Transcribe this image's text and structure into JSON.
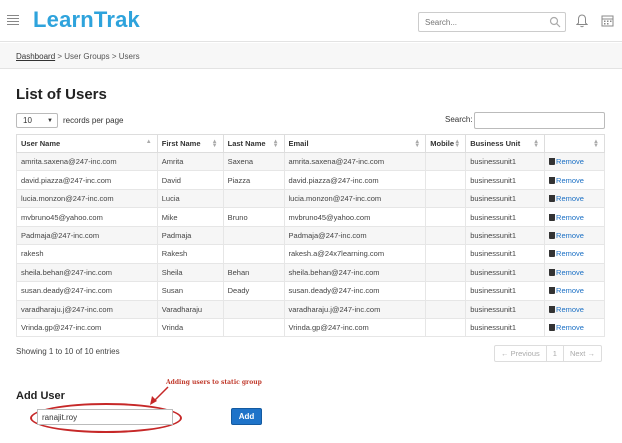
{
  "app": {
    "logo": "LearnTrak"
  },
  "header": {
    "search_placeholder": "Search..."
  },
  "breadcrumb": {
    "home": "Dashboard",
    "sep1": " > ",
    "groups": "User Groups",
    "sep2": " > ",
    "current": "Users"
  },
  "page": {
    "title": "List of Users"
  },
  "table_controls": {
    "page_length": "10",
    "records_label": "records per page",
    "search_label": "Search:"
  },
  "columns": [
    "User Name",
    "First Name",
    "Last Name",
    "Email",
    "Mobile",
    "Business Unit",
    ""
  ],
  "rows": [
    {
      "username": "amrita.saxena@247-inc.com",
      "first": "Amrita",
      "last": "Saxena",
      "email": "amrita.saxena@247-inc.com",
      "mobile": "",
      "unit": "businessunit1",
      "action": "Remove"
    },
    {
      "username": "david.piazza@247-inc.com",
      "first": "David",
      "last": "Piazza",
      "email": "david.piazza@247-inc.com",
      "mobile": "",
      "unit": "businessunit1",
      "action": "Remove"
    },
    {
      "username": "lucia.monzon@247-inc.com",
      "first": "Lucia",
      "last": "",
      "email": "lucia.monzon@247-inc.com",
      "mobile": "",
      "unit": "businessunit1",
      "action": "Remove"
    },
    {
      "username": "mvbruno45@yahoo.com",
      "first": "Mike",
      "last": "Bruno",
      "email": "mvbruno45@yahoo.com",
      "mobile": "",
      "unit": "businessunit1",
      "action": "Remove"
    },
    {
      "username": "Padmaja@247-inc.com",
      "first": "Padmaja",
      "last": "",
      "email": "Padmaja@247-inc.com",
      "mobile": "",
      "unit": "businessunit1",
      "action": "Remove"
    },
    {
      "username": "rakesh",
      "first": "Rakesh",
      "last": "",
      "email": "rakesh.a@24x7learning.com",
      "mobile": "",
      "unit": "businessunit1",
      "action": "Remove"
    },
    {
      "username": "sheila.behan@247-inc.com",
      "first": "Sheila",
      "last": "Behan",
      "email": "sheila.behan@247-inc.com",
      "mobile": "",
      "unit": "businessunit1",
      "action": "Remove"
    },
    {
      "username": "susan.deady@247-inc.com",
      "first": "Susan",
      "last": "Deady",
      "email": "susan.deady@247-inc.com",
      "mobile": "",
      "unit": "businessunit1",
      "action": "Remove"
    },
    {
      "username": "varadharaju.j@247-inc.com",
      "first": "Varadharaju",
      "last": "",
      "email": "varadharaju.j@247-inc.com",
      "mobile": "",
      "unit": "businessunit1",
      "action": "Remove"
    },
    {
      "username": "Vrinda.gp@247-inc.com",
      "first": "Vrinda",
      "last": "",
      "email": "Vrinda.gp@247-inc.com",
      "mobile": "",
      "unit": "businessunit1",
      "action": "Remove"
    }
  ],
  "table_info": "Showing 1 to 10 of 10 entries",
  "pagination": {
    "previous": "← Previous",
    "page": "1",
    "next": "Next →"
  },
  "add_user": {
    "heading": "Add User",
    "input_value": "ranajit.roy",
    "button": "Add"
  },
  "annotation": {
    "text": "Adding users to static group",
    "color": "#c62828"
  },
  "colors": {
    "brand": "#2ea3dc",
    "link": "#1a6fc4",
    "button": "#1e73c9"
  }
}
